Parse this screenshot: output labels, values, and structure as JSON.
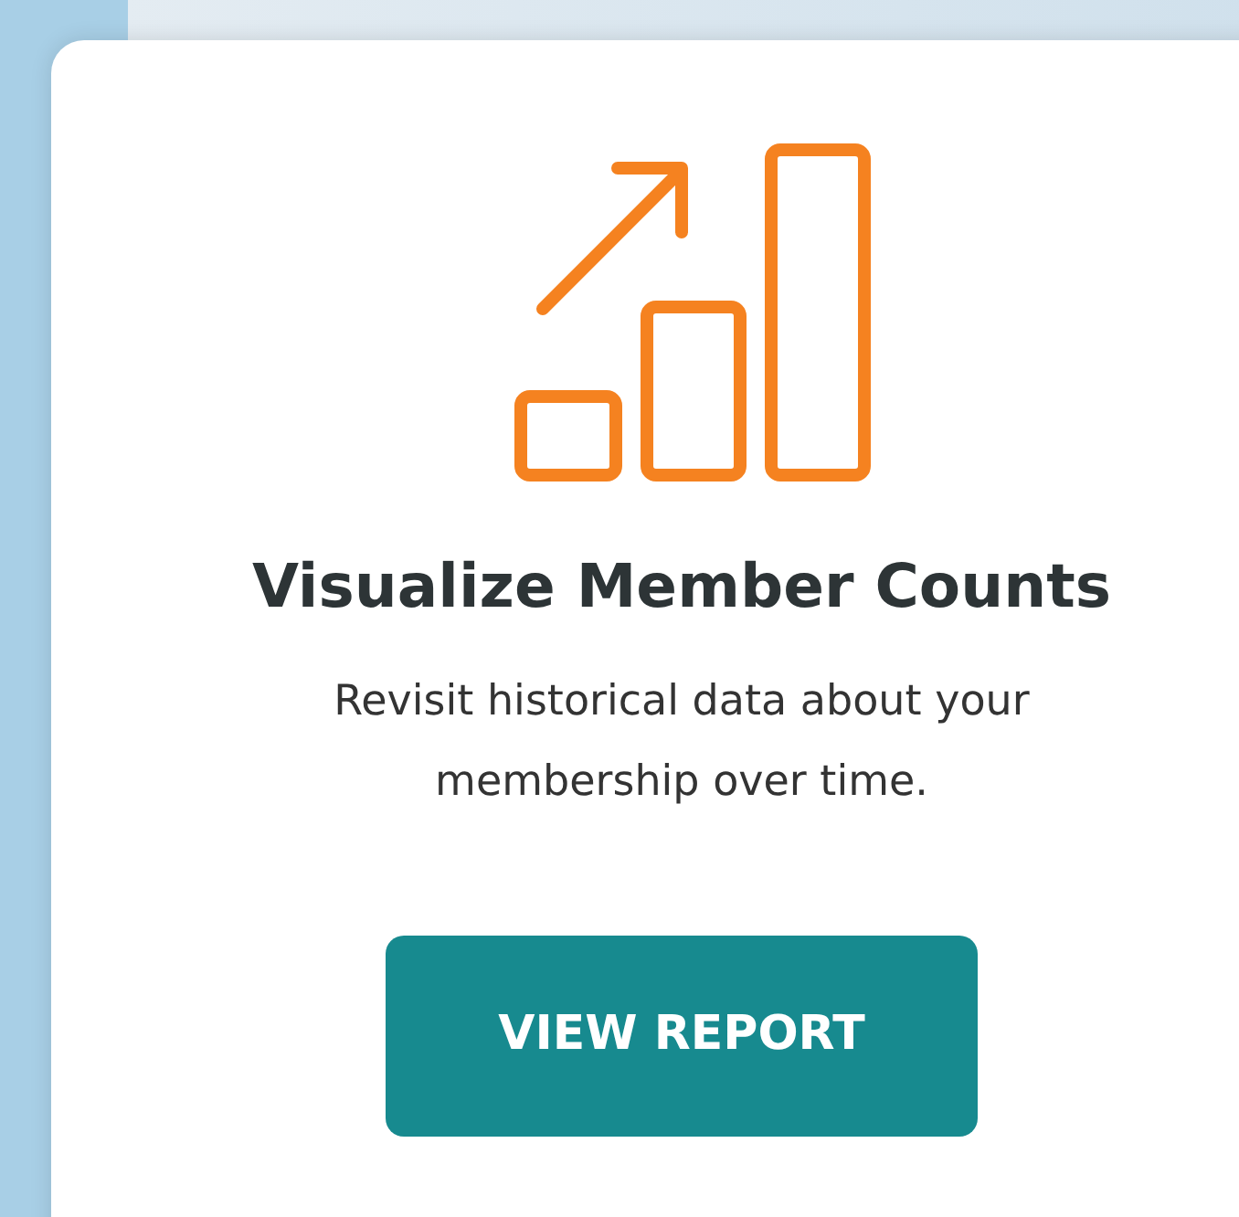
{
  "card": {
    "title": "Visualize Member Counts",
    "description": "Revisit historical data about your membership over time.",
    "button": "VIEW REPORT"
  }
}
